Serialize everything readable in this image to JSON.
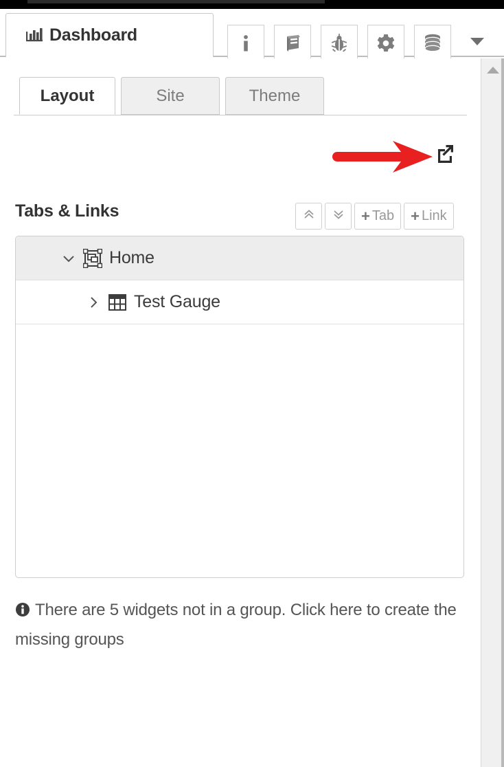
{
  "window": {
    "main_tab": {
      "label": "Dashboard",
      "icon": "bar-chart-icon"
    },
    "toolbar_buttons": [
      {
        "name": "info-button",
        "icon": "info-icon",
        "title": "i"
      },
      {
        "name": "manual-button",
        "icon": "book-icon",
        "title": "Book"
      },
      {
        "name": "debug-button",
        "icon": "bug-icon",
        "title": "Bug"
      },
      {
        "name": "settings-button",
        "icon": "gear-icon",
        "title": "Settings"
      },
      {
        "name": "database-button",
        "icon": "database-icon",
        "title": "Database"
      }
    ],
    "overflow_caret": "chevron-down-icon"
  },
  "subtabs": [
    {
      "label": "Layout",
      "active": true
    },
    {
      "label": "Site",
      "active": false
    },
    {
      "label": "Theme",
      "active": false
    }
  ],
  "annotation": {
    "arrow": "red-arrow-pointing-right",
    "arrow_color": "#E82020",
    "target": "external-link-button"
  },
  "external_link": {
    "icon": "external-link-icon",
    "label": "Open in new window"
  },
  "section": {
    "title": "Tabs & Links",
    "buttons": [
      {
        "name": "collapse-all-button",
        "icon": "chevrons-up-icon",
        "label": ""
      },
      {
        "name": "expand-all-button",
        "icon": "chevrons-down-icon",
        "label": ""
      },
      {
        "name": "add-tab-button",
        "icon": "plus-icon",
        "label": "Tab"
      },
      {
        "name": "add-link-button",
        "icon": "plus-icon",
        "label": "Link"
      }
    ]
  },
  "tree": {
    "rows": [
      {
        "label": "Home",
        "level": 0,
        "expanded": true,
        "selected": true,
        "twisty": "chevron-down-icon",
        "icon": "group-icon"
      },
      {
        "label": "Test Gauge",
        "level": 1,
        "expanded": false,
        "selected": false,
        "twisty": "chevron-right-icon",
        "icon": "table-grid-icon"
      }
    ]
  },
  "info_message": {
    "icon": "info-circle-icon",
    "text": "There are 5 widgets not in a group. Click here to create the missing groups",
    "widget_count": 5
  },
  "scrollbar": {
    "up_arrow": "triangle-up-icon",
    "position": "top"
  },
  "colors": {
    "accent_red": "#E82020",
    "tab_active_bg": "#FFFFFF",
    "tab_inactive_bg": "#EFEFEF",
    "row_selected_bg": "#EDEDED",
    "text_primary": "#333333",
    "text_muted": "#7C7C7C",
    "border": "#CFCFCF"
  }
}
